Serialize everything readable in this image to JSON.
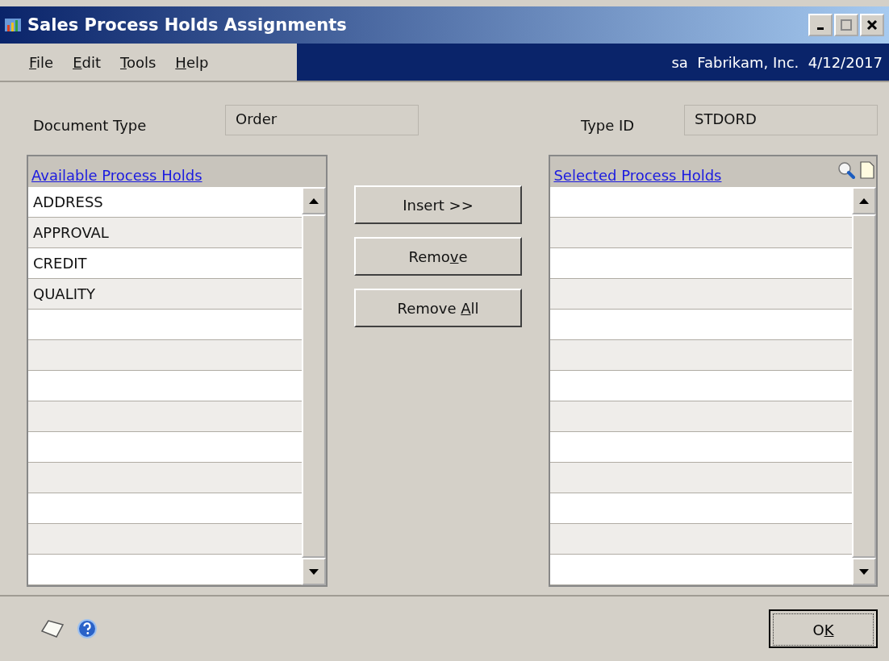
{
  "window": {
    "title": "Sales Process Holds Assignments"
  },
  "menu": [
    {
      "key": "F",
      "post": "ile"
    },
    {
      "key": "E",
      "post": "dit"
    },
    {
      "key": "T",
      "post": "ools"
    },
    {
      "key": "H",
      "post": "elp"
    }
  ],
  "session": "sa  Fabrikam, Inc.  4/12/2017",
  "document_type": {
    "label": "Document Type",
    "value": "Order"
  },
  "type_id": {
    "label": "Type ID",
    "value": "STDORD"
  },
  "available": {
    "heading": "Available Process Holds",
    "items": [
      "ADDRESS",
      "APPROVAL",
      "CREDIT",
      "QUALITY"
    ]
  },
  "buttons": [
    {
      "pre": "Insert >>"
    },
    {
      "pre": "Remo",
      "key": "v",
      "post": "e"
    },
    {
      "pre": "Remove ",
      "key": "A",
      "post": "ll"
    }
  ],
  "selected": {
    "heading": "Selected Process Holds"
  },
  "ok": {
    "pre": "O",
    "key": "K"
  }
}
